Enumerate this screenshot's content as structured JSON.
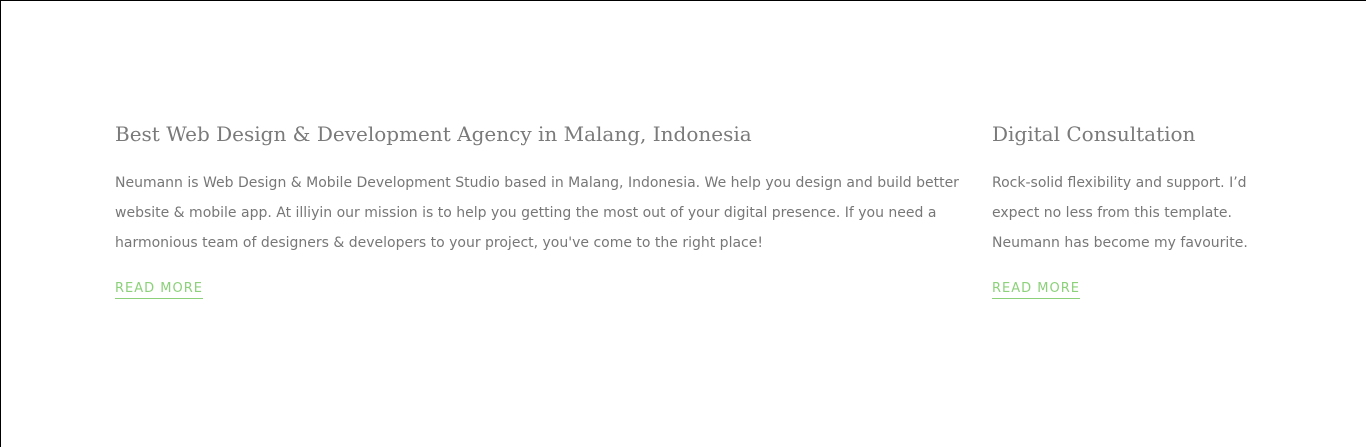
{
  "sections": [
    {
      "title": "Best Web Design & Development Agency in Malang, Indonesia",
      "lines": [
        "Neumann is Web Design & Mobile Development Studio based in Malang, Indonesia. We help you design and build better",
        "website & mobile app. At illiyin our mission is to help you getting the most out of your digital presence. If you need a",
        "harmonious team of designers & developers to your project, you've come to the right place!"
      ],
      "link_label": "READ MORE"
    },
    {
      "title": "Digital Consultation",
      "lines": [
        "Rock-solid flexibility and support. I’d",
        "expect no less from this template.",
        "Neumann has become my favourite."
      ],
      "link_label": "READ MORE"
    }
  ],
  "colors": {
    "heading": "#7a7a7a",
    "body_text": "#777777",
    "link": "#8cd17a"
  }
}
